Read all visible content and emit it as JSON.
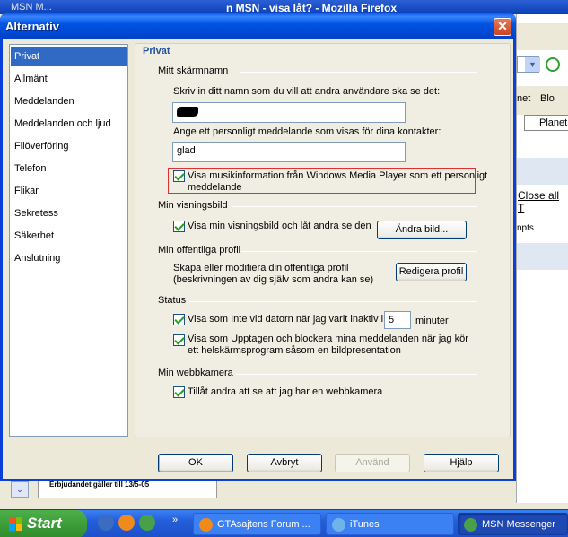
{
  "background": {
    "msn_title": "MSN M...",
    "firefox_title": "n MSN - visa låt? - Mozilla Firefox",
    "net_label": "net",
    "blo_label": "Blo",
    "planet_tab": "Planet",
    "close_all": "Close all T",
    "npts_label": "npts",
    "offer_text": "Erbjudandet gäller till 13/5-05"
  },
  "dialog": {
    "title": "Alternativ",
    "close_glyph": "✕"
  },
  "nav": {
    "items": [
      {
        "label": "Privat",
        "selected": true
      },
      {
        "label": "Allmänt"
      },
      {
        "label": "Meddelanden"
      },
      {
        "label": "Meddelanden och ljud"
      },
      {
        "label": "Filöverföring"
      },
      {
        "label": "Telefon"
      },
      {
        "label": "Flikar"
      },
      {
        "label": "Sekretess"
      },
      {
        "label": "Säkerhet"
      },
      {
        "label": "Anslutning"
      }
    ]
  },
  "panel": {
    "title": "Privat",
    "screen_name": {
      "heading": "Mitt skärmnamn",
      "name_prompt": "Skriv in ditt namn som du vill att andra användare ska se det:",
      "name_value": "",
      "message_prompt": "Ange ett personligt meddelande som visas för dina kontakter:",
      "message_value": "glad",
      "music_checkbox": "Visa musikinformation från Windows Media Player som ett personligt",
      "music_checkbox_line2": "meddelande"
    },
    "display_picture": {
      "heading": "Min visningsbild",
      "checkbox": "Visa min visningsbild och låt andra se den",
      "change_button": "Ändra bild..."
    },
    "profile": {
      "heading": "Min offentliga profil",
      "text_line1": "Skapa eller modifiera din offentliga profil",
      "text_line2": "(beskrivningen av dig själv som andra kan se)",
      "edit_button": "Redigera profil"
    },
    "status": {
      "heading": "Status",
      "away_prefix": "Visa som Inte vid datorn när jag varit inaktiv i",
      "away_minutes": "5",
      "away_suffix": "minuter",
      "busy_line1": "Visa som Upptagen och blockera mina meddelanden när jag kör",
      "busy_line2": "ett helskärmsprogram såsom en bildpresentation"
    },
    "webcam": {
      "heading": "Min webbkamera",
      "checkbox": "Tillåt andra att se att jag har en webbkamera"
    }
  },
  "buttons": {
    "ok": "OK",
    "cancel": "Avbryt",
    "apply": "Använd",
    "help": "Hjälp"
  },
  "taskbar": {
    "start": "Start",
    "overflow": "»",
    "tasks": [
      {
        "label": "GTAsajtens Forum ..."
      },
      {
        "label": "iTunes"
      },
      {
        "label": "MSN Messenger",
        "active": true
      }
    ]
  },
  "colors": {
    "title_blue": "#0054e3",
    "selection": "#316ac5",
    "highlight_border": "#e03030",
    "panel_title": "#2451a3",
    "check_green": "#21a121"
  }
}
